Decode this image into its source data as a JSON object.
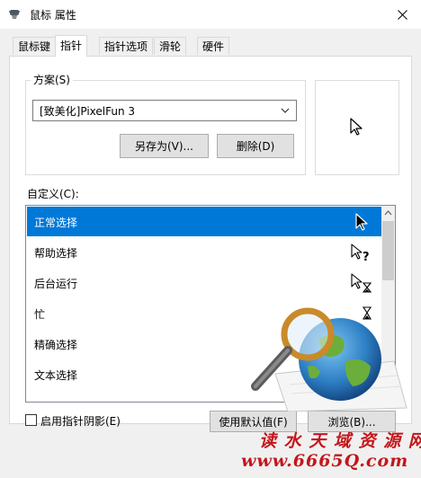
{
  "window": {
    "title": "鼠标 属性",
    "close_icon": "close-icon"
  },
  "tabs": [
    {
      "label": "鼠标键",
      "active": false
    },
    {
      "label": "指针",
      "active": true
    },
    {
      "label": "指针选项",
      "active": false
    },
    {
      "label": "滑轮",
      "active": false
    },
    {
      "label": "硬件",
      "active": false
    }
  ],
  "scheme": {
    "legend": "方案(S)",
    "selected": "[致美化]PixelFun 3",
    "save_as_label": "另存为(V)...",
    "delete_label": "删除(D)"
  },
  "custom": {
    "label": "自定义(C):",
    "items": [
      {
        "label": "正常选择",
        "icon": "arrow-cursor-icon",
        "selected": true
      },
      {
        "label": "帮助选择",
        "icon": "help-cursor-icon",
        "selected": false
      },
      {
        "label": "后台运行",
        "icon": "working-cursor-icon",
        "selected": false
      },
      {
        "label": "忙",
        "icon": "hourglass-icon",
        "selected": false
      },
      {
        "label": "精确选择",
        "icon": "",
        "selected": false
      },
      {
        "label": "文本选择",
        "icon": "",
        "selected": false
      }
    ]
  },
  "options": {
    "shadow_label": "启用指针阴影(E)",
    "shadow_checked": false,
    "default_label": "使用默认值(F)",
    "browse_label": "浏览(B)..."
  },
  "watermark": {
    "line1": "读 水 天 域 资 源 网",
    "line2": "www.6665Q.com"
  },
  "colors": {
    "selection": "#0078d7",
    "watermark": "#c4161c"
  }
}
